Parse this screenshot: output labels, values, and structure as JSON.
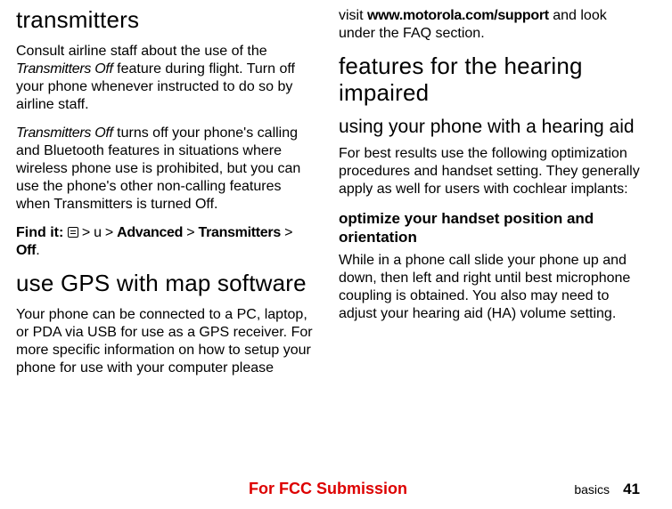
{
  "left": {
    "h1": "transmitters",
    "p1a": "Consult airline staff about the use of the ",
    "p1b": "Transmitters Off",
    "p1c": " feature during flight. Turn off your phone whenever instructed to do so by airline staff.",
    "p2a": "Transmitters Off",
    "p2b": " turns off your phone's calling and Bluetooth features in situations where wireless phone use is prohibited, but you can use the phone's other non-calling features when Transmitters is turned Off.",
    "findit_label": "Find it: ",
    "findit_gt1": " > ",
    "findit_u": "u",
    "findit_gt2": " > ",
    "findit_adv": "Advanced",
    "findit_gt3": " > ",
    "findit_tx": "Transmitters",
    "findit_gt4": " > ",
    "findit_off": "Off",
    "findit_dot": ".",
    "h2": "use GPS with map software",
    "p3": "Your phone can be connected to a PC, laptop, or PDA via USB for use as a GPS receiver. For more specific information on how to setup your phone for use with your computer please"
  },
  "right": {
    "p1a": "visit ",
    "p1b": "www.motorola.com/support",
    "p1c": " and look under the FAQ section.",
    "h1": "features for the hearing impaired",
    "h2": "using your phone with a hearing aid",
    "p2": "For best results use the following optimization procedures and handset setting. They generally apply as well for users with cochlear implants:",
    "h3": "optimize your handset position and orientation",
    "p3": "While in a phone call slide your phone up and down, then left and right until best microphone coupling is obtained.   You also may need to adjust your hearing aid (HA) volume setting."
  },
  "footer": {
    "fcc": "For FCC Submission",
    "basics": "basics",
    "page": "41"
  }
}
